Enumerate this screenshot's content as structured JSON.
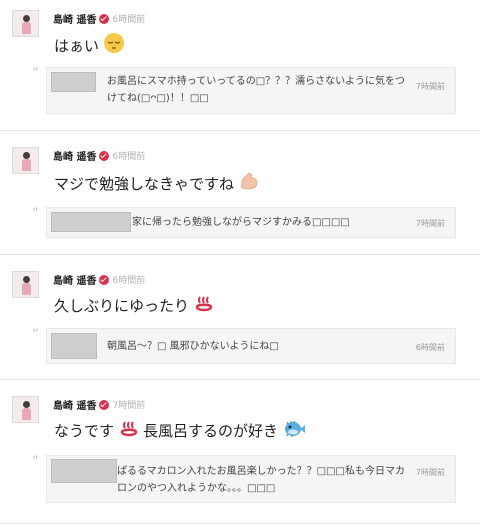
{
  "posts": [
    {
      "author": "島崎 遥香",
      "time": "6時間前",
      "message": "はぁい",
      "emoji": "sleepy-face",
      "reply": {
        "text": "お風呂にスマホ持っていってるの□？？？濡らさないように気をつけてね(□ᴖ□)！！□□",
        "time": "7時間前"
      }
    },
    {
      "author": "島崎 遥香",
      "time": "6時間前",
      "message": "マジで勉強しなきゃですね",
      "emoji": "flexed-biceps",
      "reply": {
        "text": "家に帰ったら勉強しながらマジすかみる□□□□",
        "time": "7時間前"
      }
    },
    {
      "author": "島崎 遥香",
      "time": "6時間前",
      "message": "久しぶりにゆったり",
      "emoji": "hot-springs",
      "reply": {
        "text": "朝風呂〜？□ 風邪ひかないようにね□",
        "time": "6時間前"
      }
    },
    {
      "author": "島崎 遥香",
      "time": "7時間前",
      "message_before": "なうです",
      "emoji_mid": "hot-springs",
      "message_after": "長風呂するのが好き",
      "emoji": "blowfish",
      "reply": {
        "text": "ぱるるマカロン入れたお風呂楽しかった？？□□□私も今日マカロンのやつ入れようかな。。。□□□",
        "time": "7時間前"
      }
    }
  ],
  "colors": {
    "verified": "#d9304c",
    "hot_springs": "#d9304c",
    "reply_bg": "#f5f5f5"
  }
}
